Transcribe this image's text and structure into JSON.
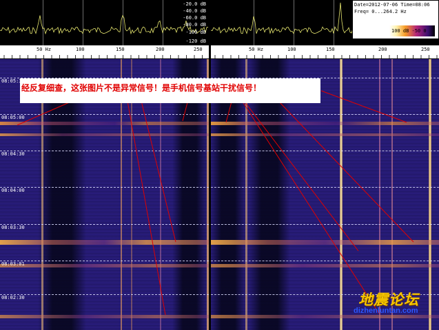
{
  "header": {
    "date_line": "Date=2012-07-06 Time=08:06",
    "freq_line": "Freq= 0...264.2 Hz",
    "colorbar_labels": "100 dB   -50    0"
  },
  "spectrum": {
    "db_labels": [
      "-20.0 dB",
      "-40.0 dB",
      "-60.0 dB",
      "-80.0 dB",
      "-100 dB",
      "-120 dB"
    ]
  },
  "axis": {
    "tick_labels": [
      "50 Hz",
      "100",
      "150",
      "200",
      "250"
    ]
  },
  "waterfall": {
    "time_labels": [
      "08:05:30",
      "08:05:00",
      "08:04:30",
      "08:04:00",
      "08:03:30",
      "08:03:01",
      "08:02:30"
    ]
  },
  "annotation": {
    "text": "经反复细查，这张图片不是异常信号！是手机信号基站干扰信号！"
  },
  "watermark": {
    "title": "地震论坛",
    "url": "dizhenluntan.com"
  },
  "colors": {
    "background": "#000000",
    "annotation_red": "#e00000",
    "spectrum_trace": "#e8e870",
    "waterfall_base": "#24196f",
    "bright_line": "#ffd070",
    "watermark_gold": "#f6c500",
    "watermark_blue": "#2c57ff"
  }
}
